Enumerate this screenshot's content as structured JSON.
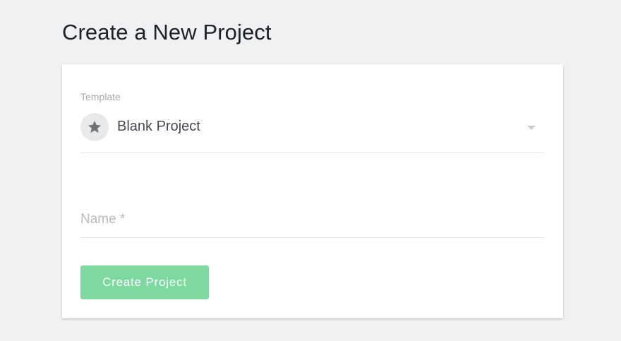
{
  "page": {
    "title": "Create a New Project"
  },
  "form": {
    "template_label": "Template",
    "template_value": "Blank Project",
    "template_icon": "star-icon",
    "name_placeholder": "Name *",
    "name_value": "",
    "submit_label": "Create Project"
  },
  "colors": {
    "background": "#f0f1f3",
    "card": "#ffffff",
    "button": "#7dd9a0",
    "icon": "#6f7378"
  }
}
